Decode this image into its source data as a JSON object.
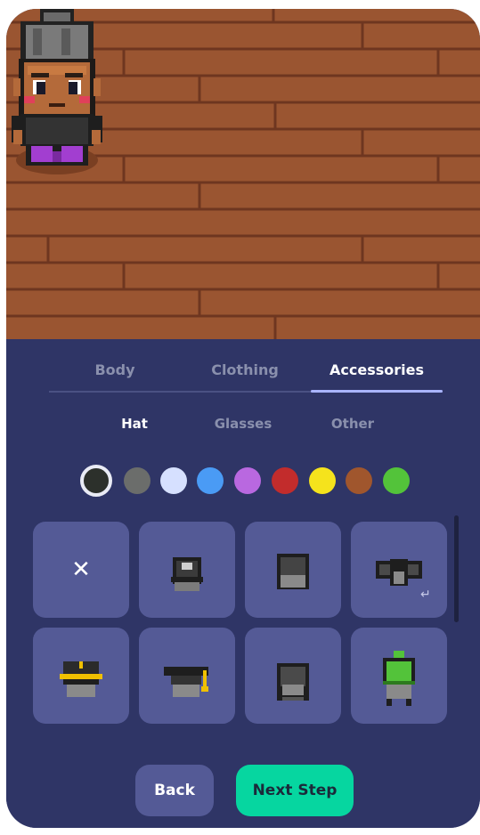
{
  "tabs": [
    {
      "label": "Body",
      "active": false
    },
    {
      "label": "Clothing",
      "active": false
    },
    {
      "label": "Accessories",
      "active": true
    }
  ],
  "subtabs": [
    {
      "label": "Hat",
      "active": true
    },
    {
      "label": "Glasses",
      "active": false
    },
    {
      "label": "Other",
      "active": false
    }
  ],
  "colors": {
    "selected_index": 0,
    "swatches": [
      "#2c302b",
      "#6b6d6b",
      "#d6e0ff",
      "#4a9bf5",
      "#b968e0",
      "#c22c2c",
      "#f5e31c",
      "#a0562d",
      "#53c33a"
    ]
  },
  "hats": [
    {
      "name": "none",
      "symbol": "✕"
    },
    {
      "name": "baseball-cap-icon"
    },
    {
      "name": "beanie-icon"
    },
    {
      "name": "bat-wings-icon",
      "has_indicator": true
    },
    {
      "name": "police-cap-icon"
    },
    {
      "name": "graduation-cap-icon"
    },
    {
      "name": "hood-icon"
    },
    {
      "name": "green-beanie-icon"
    }
  ],
  "buttons": {
    "back": "Back",
    "next": "Next Step"
  },
  "theme": {
    "floor": "#9a5531",
    "floor_line": "#6e3620",
    "panel": "#2f3566",
    "card": "#545a96",
    "accent": "#06d6a0",
    "tab_indicator": "#a9b4ff"
  }
}
